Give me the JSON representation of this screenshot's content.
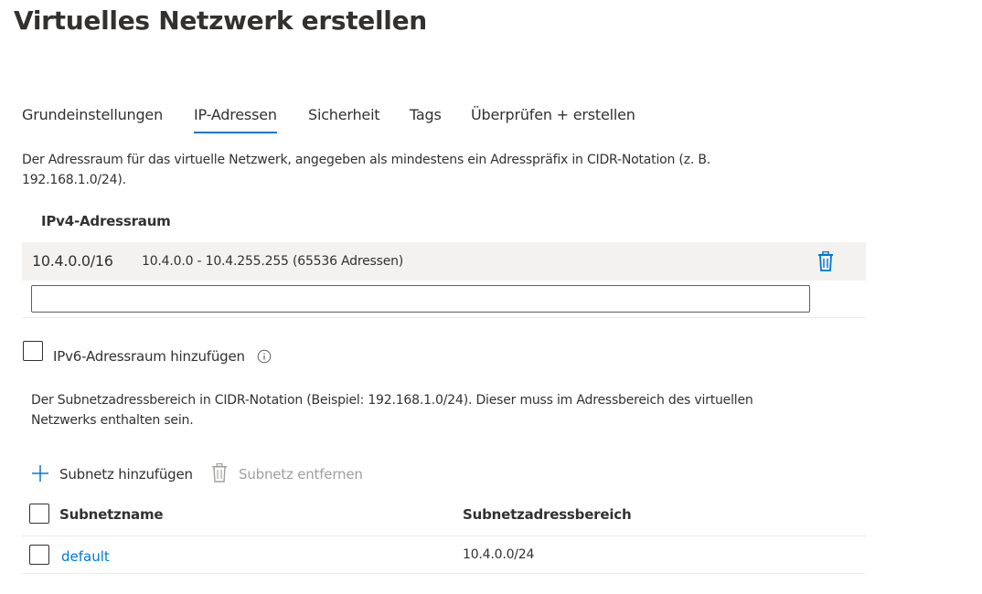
{
  "page": {
    "title": "Virtuelles Netzwerk erstellen"
  },
  "tabs": [
    {
      "label": "Grundeinstellungen",
      "active": false
    },
    {
      "label": "IP-Adressen",
      "active": true
    },
    {
      "label": "Sicherheit",
      "active": false
    },
    {
      "label": "Tags",
      "active": false
    },
    {
      "label": "Überprüfen + erstellen",
      "active": false
    }
  ],
  "address_space": {
    "description_line1": "Der Adressraum für das virtuelle Netzwerk, angegeben als mindestens ein Adresspräfix in CIDR-Notation (z. B.",
    "description_line2": "192.168.1.0/24).",
    "section_label": "IPv4-Adressraum",
    "entries": [
      {
        "prefix": "10.4.0.0/16",
        "range": "10.4.0.0 - 10.4.255.255 (65536 Adressen)"
      }
    ],
    "new_input_value": "",
    "delete_icon": "trash-icon"
  },
  "ipv6": {
    "checkbox_label": "IPv6-Adressraum hinzufügen",
    "checked": false,
    "info_icon": "info-icon"
  },
  "subnets": {
    "description_line1": "Der Subnetzadressbereich in CIDR-Notation (Beispiel: 192.168.1.0/24). Dieser muss im Adressbereich des virtuellen",
    "description_line2": "Netzwerks enthalten sein.",
    "add_label": "Subnetz hinzufügen",
    "remove_label": "Subnetz entfernen",
    "columns": [
      "Subnetzname",
      "Subnetzadressbereich"
    ],
    "rows": [
      {
        "name": "default",
        "range": "10.4.0.0/24"
      }
    ]
  },
  "colors": {
    "accent": "#0078d4",
    "text": "#323130",
    "row_bg": "#f3f2f1",
    "disabled": "#a19f9d"
  }
}
